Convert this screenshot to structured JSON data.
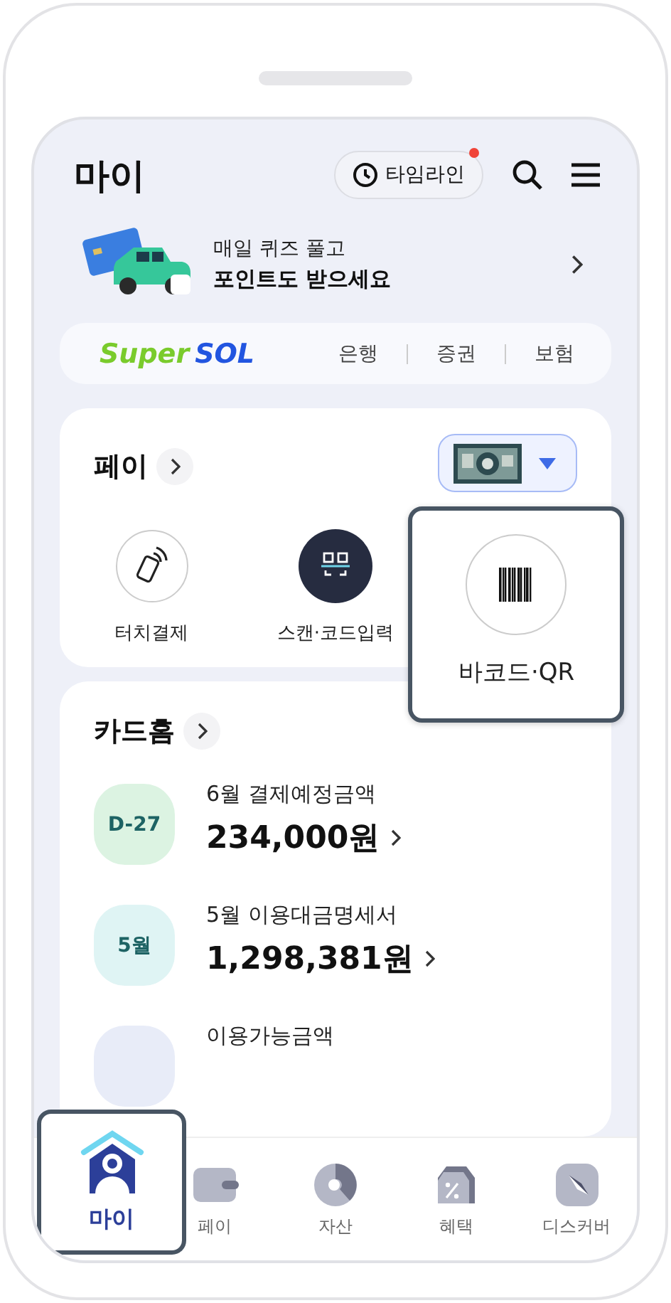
{
  "header": {
    "title": "마이",
    "timeline_button": {
      "label": "타임라인",
      "notification": true
    }
  },
  "banner": {
    "line_1": "매일 퀴즈 풀고",
    "line_2": "포인트도 받으세요"
  },
  "supersol": {
    "logo_1": "Super",
    "logo_2": "SOL",
    "links": [
      "은행",
      "증권",
      "보험"
    ]
  },
  "pay": {
    "title": "페이",
    "actions": [
      {
        "kind": "touch",
        "label": "터치결제",
        "highlighted": false
      },
      {
        "kind": "scan",
        "label": "스캔·코드입력",
        "highlighted": false
      },
      {
        "kind": "barcode",
        "label": "바코드·QR",
        "highlighted": true
      }
    ]
  },
  "card_home": {
    "title": "카드홈",
    "items": [
      {
        "badge": "D-27",
        "color": "#dcf3e2",
        "label": "6월 결제예정금액",
        "amount": "234,000원"
      },
      {
        "badge": "5월",
        "color": "#dff4f4",
        "label": "5월 이용대금명세서",
        "amount": "1,298,381원"
      },
      {
        "color": "#e8ecf8",
        "label": "이용가능금액"
      }
    ]
  },
  "bottom_nav": [
    {
      "kind": "my",
      "label": "마이",
      "selected": true
    },
    {
      "kind": "wallet",
      "label": "페이",
      "selected": false
    },
    {
      "kind": "assets",
      "label": "자산",
      "selected": false
    },
    {
      "kind": "benefit",
      "label": "혜택",
      "selected": false
    },
    {
      "kind": "discover",
      "label": "디스커버",
      "selected": false
    }
  ]
}
